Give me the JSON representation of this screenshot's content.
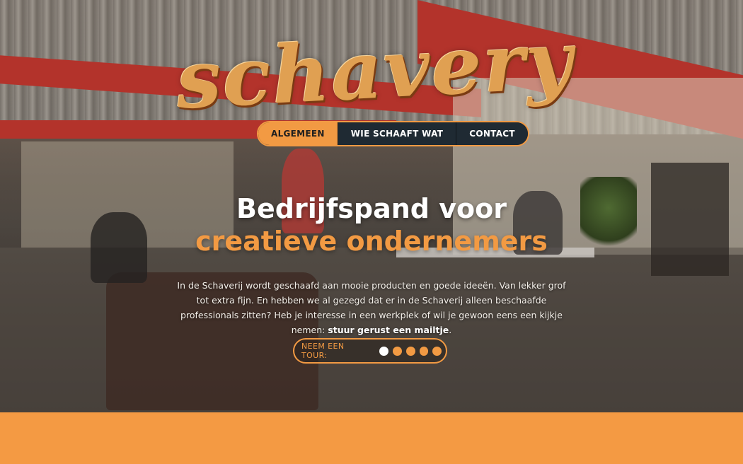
{
  "logo": {
    "text": "schavery"
  },
  "nav": {
    "items": [
      {
        "label": "ALGEMEEN",
        "active": true
      },
      {
        "label": "WIE SCHAAFT WAT",
        "active": false
      },
      {
        "label": "CONTACT",
        "active": false
      }
    ]
  },
  "hero": {
    "title_line1": "Bedrijfspand voor",
    "title_line2": "creatieve ondernemers",
    "intro_text": "In de Schaverij wordt geschaafd aan mooie producten en goede ideeën. Van lekker grof tot extra fijn. En hebben we al gezegd dat er in de Schaverij alleen beschaafde professionals zitten? Heb je interesse in een werkplek of wil je gewoon eens een kijkje nemen:",
    "mail_link": "stuur gerust een mailtje",
    "intro_end": "."
  },
  "tour": {
    "label": "NEEM EEN TOUR:",
    "dots": 5,
    "active_dot": 1
  },
  "colors": {
    "accent": "#f29a43",
    "nav_bg": "#1f2a33",
    "band": "#f49a43"
  }
}
